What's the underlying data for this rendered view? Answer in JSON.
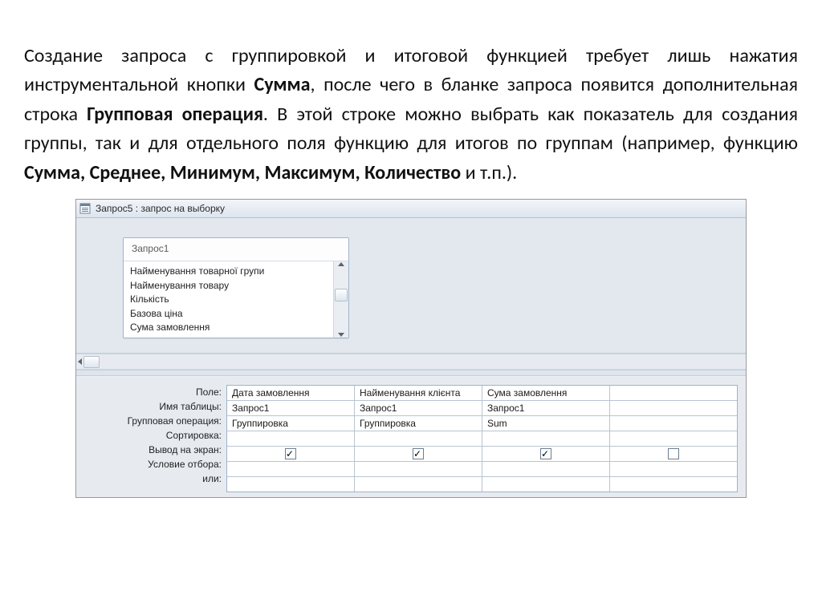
{
  "prose": {
    "s1a": "Создание запроса с группировкой и итоговой функцией требует лишь нажатия инструментальной кнопки ",
    "s1b": "Сумма",
    "s1c": ", после чего в бланке запроса появится дополнительная строка ",
    "s1d": "Групповая операция",
    "s1e": ". В этой строке можно выбрать как показатель для создания группы, так и для отдельного поля функцию для итогов по группам (например, функцию ",
    "s1f": "Сумма, Среднее, Минимум, Максимум, Количество",
    "s1g": " и т.п.)."
  },
  "window": {
    "title": "Запрос5 : запрос на выборку"
  },
  "field_list": {
    "title": "Запрос1",
    "items": [
      "Найменування товарної групи",
      "Найменування товару",
      "Кількість",
      "Базова ціна",
      "Сума замовлення"
    ]
  },
  "grid": {
    "labels": {
      "field": "Поле:",
      "table": "Имя таблицы:",
      "group": "Групповая операция:",
      "sort": "Сортировка:",
      "show": "Вывод на экран:",
      "criteria": "Условие отбора:",
      "or": "или:"
    },
    "columns": [
      {
        "field": "Дата замовлення",
        "table": "Запрос1",
        "group": "Группировка",
        "sort": "",
        "show": true,
        "criteria": "",
        "or": ""
      },
      {
        "field": "Найменування клієнта",
        "table": "Запрос1",
        "group": "Группировка",
        "sort": "",
        "show": true,
        "criteria": "",
        "or": ""
      },
      {
        "field": "Сума замовлення",
        "table": "Запрос1",
        "group": "Sum",
        "sort": "",
        "show": true,
        "criteria": "",
        "or": ""
      }
    ]
  }
}
